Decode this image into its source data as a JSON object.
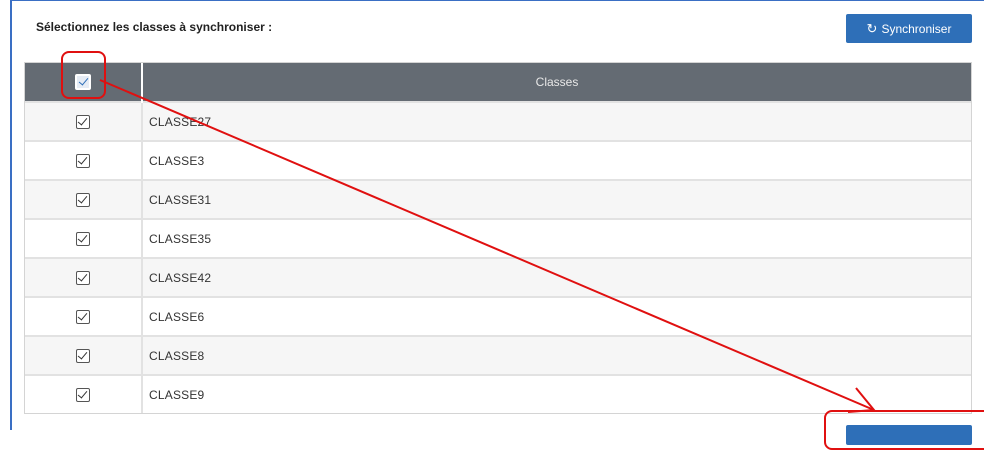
{
  "header": {
    "title": "Sélectionnez les classes à synchroniser :",
    "sync_button": "Synchroniser",
    "sync_icon": "refresh-icon"
  },
  "table": {
    "column_header": "Classes",
    "select_all_checked": true,
    "rows": [
      {
        "name": "CLASSE27",
        "checked": true
      },
      {
        "name": "CLASSE3",
        "checked": true
      },
      {
        "name": "CLASSE31",
        "checked": true
      },
      {
        "name": "CLASSE35",
        "checked": true
      },
      {
        "name": "CLASSE42",
        "checked": true
      },
      {
        "name": "CLASSE6",
        "checked": true
      },
      {
        "name": "CLASSE8",
        "checked": true
      },
      {
        "name": "CLASSE9",
        "checked": true
      }
    ]
  },
  "colors": {
    "accent": "#2e6fb8",
    "table_header_bg": "#646b73",
    "annotation": "#e01010"
  }
}
